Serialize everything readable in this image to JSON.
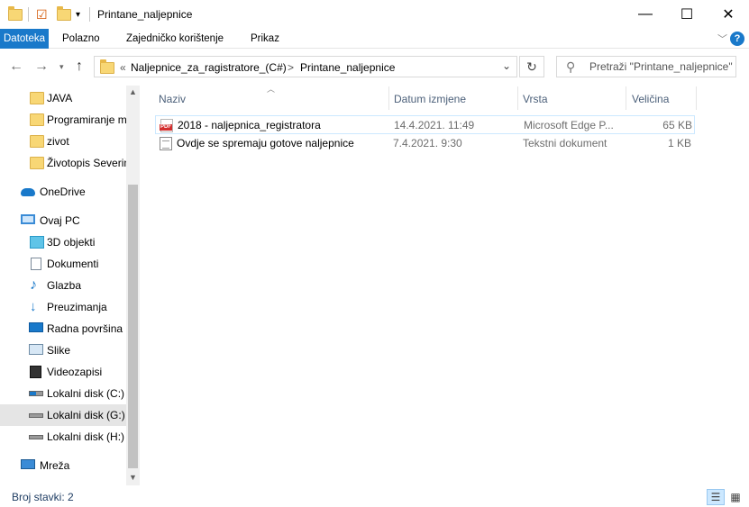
{
  "window": {
    "title": "Printane_naljepnice",
    "controls": {
      "minimize": "—",
      "maximize": "☐",
      "close": "✕"
    }
  },
  "ribbon": {
    "tabs": [
      "Datoteka",
      "Polazno",
      "Zajedničko korištenje",
      "Prikaz"
    ],
    "active_tab": "Datoteka",
    "help": "?"
  },
  "address": {
    "prefix": "«",
    "crumbs": [
      "Naljepnice_za_ragistratore_(C#)",
      "Printane_naljepnice"
    ],
    "separator": ">"
  },
  "search": {
    "placeholder": "Pretraži \"Printane_naljepnice\""
  },
  "nav_pane": {
    "items": [
      {
        "label": "JAVA",
        "icon": "folder-icon"
      },
      {
        "label": "Programiranje m",
        "icon": "folder-icon"
      },
      {
        "label": "zivot",
        "icon": "folder-icon"
      },
      {
        "label": "Životopis Severin",
        "icon": "folder-icon"
      },
      {
        "label": "OneDrive",
        "icon": "cloud-icon"
      },
      {
        "label": "Ovaj PC",
        "icon": "computer-icon"
      },
      {
        "label": "3D objekti",
        "icon": "cube-icon"
      },
      {
        "label": "Dokumenti",
        "icon": "document-icon"
      },
      {
        "label": "Glazba",
        "icon": "music-icon"
      },
      {
        "label": "Preuzimanja",
        "icon": "download-icon"
      },
      {
        "label": "Radna površina",
        "icon": "desktop-icon"
      },
      {
        "label": "Slike",
        "icon": "picture-icon"
      },
      {
        "label": "Videozapisi",
        "icon": "video-icon"
      },
      {
        "label": "Lokalni disk (C:)",
        "icon": "drive-icon"
      },
      {
        "label": "Lokalni disk (G:)",
        "icon": "drive-icon",
        "selected": true
      },
      {
        "label": "Lokalni disk (H:)",
        "icon": "drive-icon"
      },
      {
        "label": "Mreža",
        "icon": "network-icon"
      }
    ]
  },
  "columns": {
    "name": "Naziv",
    "date": "Datum izmjene",
    "type": "Vrsta",
    "size": "Veličina"
  },
  "files": [
    {
      "name": "2018  - naljepnica_registratora",
      "date": "14.4.2021. 11:49",
      "type": "Microsoft Edge P...",
      "size": "65 KB",
      "icon": "pdf-icon",
      "pdf_badge": "PDF"
    },
    {
      "name": "Ovdje se spremaju gotove naljepnice",
      "date": "7.4.2021. 9:30",
      "type": "Tekstni dokument",
      "size": "1 KB",
      "icon": "text-file-icon"
    }
  ],
  "status": {
    "item_count": "Broj stavki: 2"
  }
}
